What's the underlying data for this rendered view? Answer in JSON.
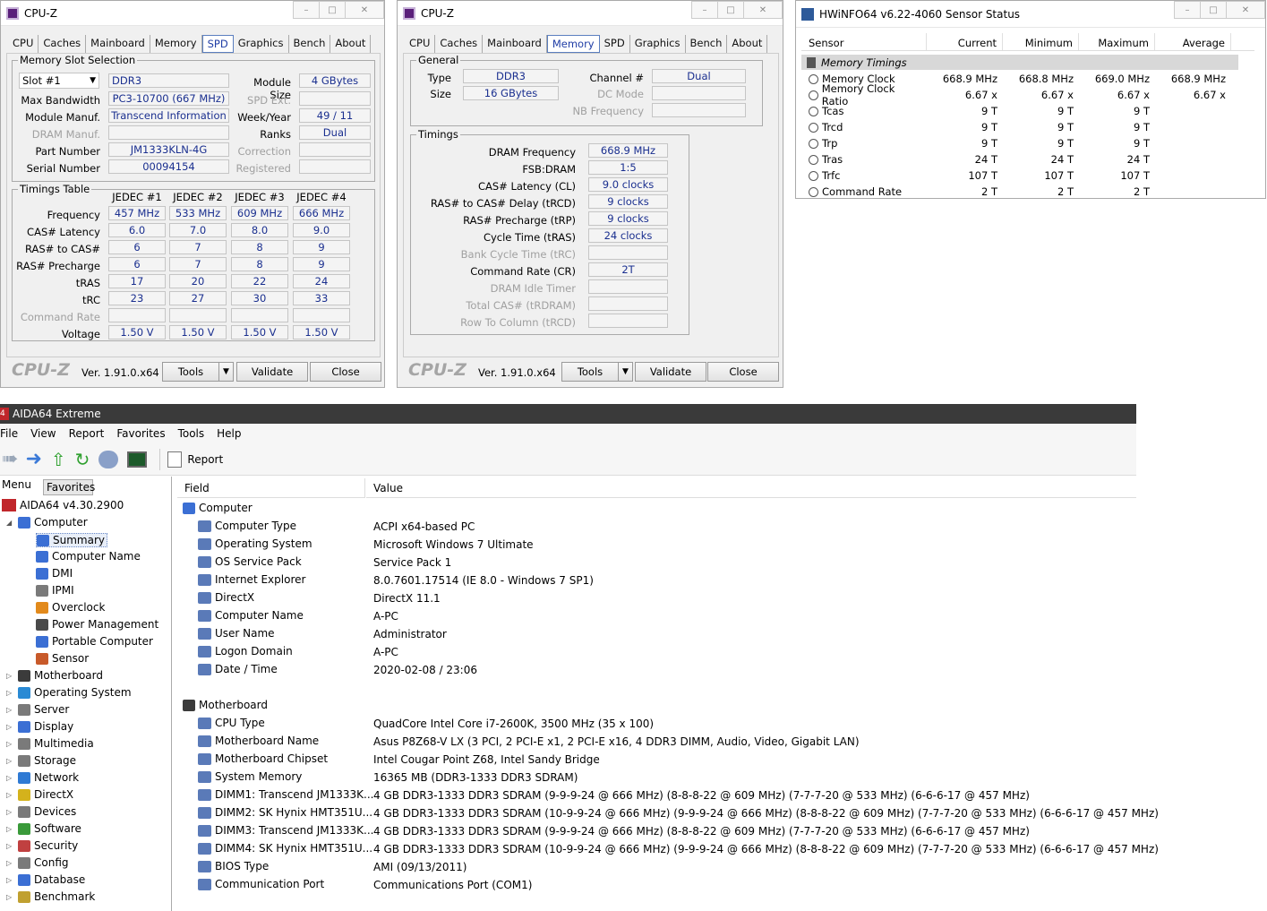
{
  "cpuz_common": {
    "title": "CPU-Z",
    "tabs": [
      "CPU",
      "Caches",
      "Mainboard",
      "Memory",
      "SPD",
      "Graphics",
      "Bench",
      "About"
    ],
    "logo": "CPU-Z",
    "version": "Ver. 1.91.0.x64",
    "tools": "Tools",
    "validate": "Validate",
    "close": "Close"
  },
  "spd": {
    "group_slot": "Memory Slot Selection",
    "slot": "Slot #1",
    "type": "DDR3",
    "module_size_label": "Module Size",
    "module_size": "4 GBytes",
    "max_bw_label": "Max Bandwidth",
    "max_bw": "PC3-10700 (667 MHz)",
    "spd_ext_label": "SPD Ext.",
    "manuf_label": "Module Manuf.",
    "manuf": "Transcend Information",
    "week_label": "Week/Year",
    "week": "49 / 11",
    "dram_manuf_label": "DRAM Manuf.",
    "ranks_label": "Ranks",
    "ranks": "Dual",
    "part_label": "Part Number",
    "part": "JM1333KLN-4G",
    "correction_label": "Correction",
    "serial_label": "Serial Number",
    "serial": "00094154",
    "registered_label": "Registered",
    "group_timings": "Timings Table",
    "cols": [
      "JEDEC #1",
      "JEDEC #2",
      "JEDEC #3",
      "JEDEC #4"
    ],
    "rows": [
      {
        "label": "Frequency",
        "v": [
          "457 MHz",
          "533 MHz",
          "609 MHz",
          "666 MHz"
        ]
      },
      {
        "label": "CAS# Latency",
        "v": [
          "6.0",
          "7.0",
          "8.0",
          "9.0"
        ]
      },
      {
        "label": "RAS# to CAS#",
        "v": [
          "6",
          "7",
          "8",
          "9"
        ]
      },
      {
        "label": "RAS# Precharge",
        "v": [
          "6",
          "7",
          "8",
          "9"
        ]
      },
      {
        "label": "tRAS",
        "v": [
          "17",
          "20",
          "22",
          "24"
        ]
      },
      {
        "label": "tRC",
        "v": [
          "23",
          "27",
          "30",
          "33"
        ]
      },
      {
        "label": "Command Rate",
        "v": [
          "",
          "",
          "",
          ""
        ]
      },
      {
        "label": "Voltage",
        "v": [
          "1.50 V",
          "1.50 V",
          "1.50 V",
          "1.50 V"
        ]
      }
    ]
  },
  "mem": {
    "group_general": "General",
    "type_label": "Type",
    "type": "DDR3",
    "channel_label": "Channel #",
    "channel": "Dual",
    "size_label": "Size",
    "size": "16 GBytes",
    "dcmode_label": "DC Mode",
    "nbfreq_label": "NB Frequency",
    "group_timings": "Timings",
    "rows": [
      {
        "label": "DRAM Frequency",
        "v": "668.9 MHz"
      },
      {
        "label": "FSB:DRAM",
        "v": "1:5"
      },
      {
        "label": "CAS# Latency (CL)",
        "v": "9.0 clocks"
      },
      {
        "label": "RAS# to CAS# Delay (tRCD)",
        "v": "9 clocks"
      },
      {
        "label": "RAS# Precharge (tRP)",
        "v": "9 clocks"
      },
      {
        "label": "Cycle Time (tRAS)",
        "v": "24 clocks"
      },
      {
        "label": "Bank Cycle Time (tRC)",
        "v": ""
      },
      {
        "label": "Command Rate (CR)",
        "v": "2T"
      },
      {
        "label": "DRAM Idle Timer",
        "v": ""
      },
      {
        "label": "Total CAS# (tRDRAM)",
        "v": ""
      },
      {
        "label": "Row To Column (tRCD)",
        "v": ""
      }
    ]
  },
  "hwinfo": {
    "title": "HWiNFO64 v6.22-4060 Sensor Status",
    "headers": [
      "Sensor",
      "Current",
      "Minimum",
      "Maximum",
      "Average"
    ],
    "group": "Memory Timings",
    "rows": [
      {
        "n": "Memory Clock",
        "c": "668.9 MHz",
        "mi": "668.8 MHz",
        "ma": "669.0 MHz",
        "a": "668.9 MHz"
      },
      {
        "n": "Memory Clock Ratio",
        "c": "6.67 x",
        "mi": "6.67 x",
        "ma": "6.67 x",
        "a": "6.67 x"
      },
      {
        "n": "Tcas",
        "c": "9 T",
        "mi": "9 T",
        "ma": "9 T",
        "a": ""
      },
      {
        "n": "Trcd",
        "c": "9 T",
        "mi": "9 T",
        "ma": "9 T",
        "a": ""
      },
      {
        "n": "Trp",
        "c": "9 T",
        "mi": "9 T",
        "ma": "9 T",
        "a": ""
      },
      {
        "n": "Tras",
        "c": "24 T",
        "mi": "24 T",
        "ma": "24 T",
        "a": ""
      },
      {
        "n": "Trfc",
        "c": "107 T",
        "mi": "107 T",
        "ma": "107 T",
        "a": ""
      },
      {
        "n": "Command Rate",
        "c": "2 T",
        "mi": "2 T",
        "ma": "2 T",
        "a": ""
      }
    ]
  },
  "aida": {
    "title": "AIDA64 Extreme",
    "menu": [
      "File",
      "View",
      "Report",
      "Favorites",
      "Tools",
      "Help"
    ],
    "report": "Report",
    "tab_menu": "Menu",
    "tab_fav": "Favorites",
    "root": "AIDA64 v4.30.2900",
    "tree": [
      "Computer",
      "Summary",
      "Computer Name",
      "DMI",
      "IPMI",
      "Overclock",
      "Power Management",
      "Portable Computer",
      "Sensor",
      "Motherboard",
      "Operating System",
      "Server",
      "Display",
      "Multimedia",
      "Storage",
      "Network",
      "DirectX",
      "Devices",
      "Software",
      "Security",
      "Config",
      "Database",
      "Benchmark"
    ],
    "col_field": "Field",
    "col_value": "Value",
    "sec1": "Computer",
    "items1": [
      {
        "f": "Computer Type",
        "v": "ACPI x64-based PC"
      },
      {
        "f": "Operating System",
        "v": "Microsoft Windows 7 Ultimate"
      },
      {
        "f": "OS Service Pack",
        "v": "Service Pack 1"
      },
      {
        "f": "Internet Explorer",
        "v": "8.0.7601.17514 (IE 8.0 - Windows 7 SP1)"
      },
      {
        "f": "DirectX",
        "v": "DirectX 11.1"
      },
      {
        "f": "Computer Name",
        "v": "A-PC"
      },
      {
        "f": "User Name",
        "v": "Administrator"
      },
      {
        "f": "Logon Domain",
        "v": "A-PC"
      },
      {
        "f": "Date / Time",
        "v": "2020-02-08 / 23:06"
      }
    ],
    "sec2": "Motherboard",
    "items2": [
      {
        "f": "CPU Type",
        "v": "QuadCore Intel Core i7-2600K, 3500 MHz (35 x 100)"
      },
      {
        "f": "Motherboard Name",
        "v": "Asus P8Z68-V LX  (3 PCI, 2 PCI-E x1, 2 PCI-E x16, 4 DDR3 DIMM, Audio, Video, Gigabit LAN)"
      },
      {
        "f": "Motherboard Chipset",
        "v": "Intel Cougar Point Z68, Intel Sandy Bridge"
      },
      {
        "f": "System Memory",
        "v": "16365 MB  (DDR3-1333 DDR3 SDRAM)"
      },
      {
        "f": "DIMM1: Transcend JM1333K...",
        "v": "4 GB DDR3-1333 DDR3 SDRAM  (9-9-9-24 @ 666 MHz)  (8-8-8-22 @ 609 MHz)  (7-7-7-20 @ 533 MHz)  (6-6-6-17 @ 457 MHz)"
      },
      {
        "f": "DIMM2: SK Hynix HMT351U...",
        "v": "4 GB DDR3-1333 DDR3 SDRAM  (10-9-9-24 @ 666 MHz)  (9-9-9-24 @ 666 MHz)  (8-8-8-22 @ 609 MHz)  (7-7-7-20 @ 533 MHz)  (6-6-6-17 @ 457 MHz)"
      },
      {
        "f": "DIMM3: Transcend JM1333K...",
        "v": "4 GB DDR3-1333 DDR3 SDRAM  (9-9-9-24 @ 666 MHz)  (8-8-8-22 @ 609 MHz)  (7-7-7-20 @ 533 MHz)  (6-6-6-17 @ 457 MHz)"
      },
      {
        "f": "DIMM4: SK Hynix HMT351U...",
        "v": "4 GB DDR3-1333 DDR3 SDRAM  (10-9-9-24 @ 666 MHz)  (9-9-9-24 @ 666 MHz)  (8-8-8-22 @ 609 MHz)  (7-7-7-20 @ 533 MHz)  (6-6-6-17 @ 457 MHz)"
      },
      {
        "f": "BIOS Type",
        "v": "AMI (09/13/2011)"
      },
      {
        "f": "Communication Port",
        "v": "Communications Port (COM1)"
      }
    ]
  }
}
